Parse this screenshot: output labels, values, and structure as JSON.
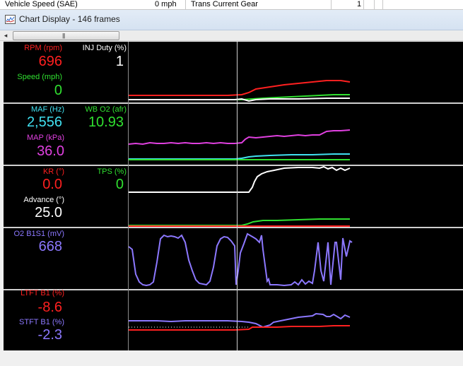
{
  "top_row": {
    "col1_name": "Vehicle Speed (SAE)",
    "col1_value": "0 mph",
    "col2_name": "Trans Current Gear",
    "col2_value": "1"
  },
  "window": {
    "title": "Chart Display",
    "separator": "-",
    "frames": "146 frames"
  },
  "scrollbar": {
    "left_arrow": "◂",
    "grip": "|||"
  },
  "colors": {
    "red": "#ff2020",
    "green": "#30e030",
    "white": "#ffffff",
    "cyan": "#40e0f0",
    "magenta": "#e040e0",
    "purple": "#8c78ff",
    "bg": "#000000"
  },
  "panels": [
    {
      "id": "panel1",
      "readouts": [
        {
          "label": "RPM (rpm)",
          "value": "696",
          "color": "red"
        },
        {
          "label": "INJ Duty (%)",
          "value": "1",
          "color": "white"
        },
        {
          "label": "Speed (mph)",
          "value": "0",
          "color": "green"
        }
      ]
    },
    {
      "id": "panel2",
      "readouts": [
        {
          "label": "MAF (Hz)",
          "value": "2,556",
          "color": "cyan"
        },
        {
          "label": "WB O2 (afr)",
          "value": "10.93",
          "color": "green"
        },
        {
          "label": "MAP (kPa)",
          "value": "36.0",
          "color": "magenta"
        }
      ]
    },
    {
      "id": "panel3",
      "readouts": [
        {
          "label": "KR (°)",
          "value": "0.0",
          "color": "red"
        },
        {
          "label": "TPS (%)",
          "value": "0",
          "color": "green"
        },
        {
          "label": "Advance (°)",
          "value": "25.0",
          "color": "white"
        }
      ]
    },
    {
      "id": "panel4",
      "readouts": [
        {
          "label": "O2 B1S1 (mV)",
          "value": "668",
          "color": "purple"
        }
      ]
    },
    {
      "id": "panel5",
      "readouts": [
        {
          "label": "LTFT B1 (%)",
          "value": "-8.6",
          "color": "red"
        },
        {
          "label": "STFT B1 (%)",
          "value": "-2.3",
          "color": "purple"
        }
      ]
    }
  ]
}
